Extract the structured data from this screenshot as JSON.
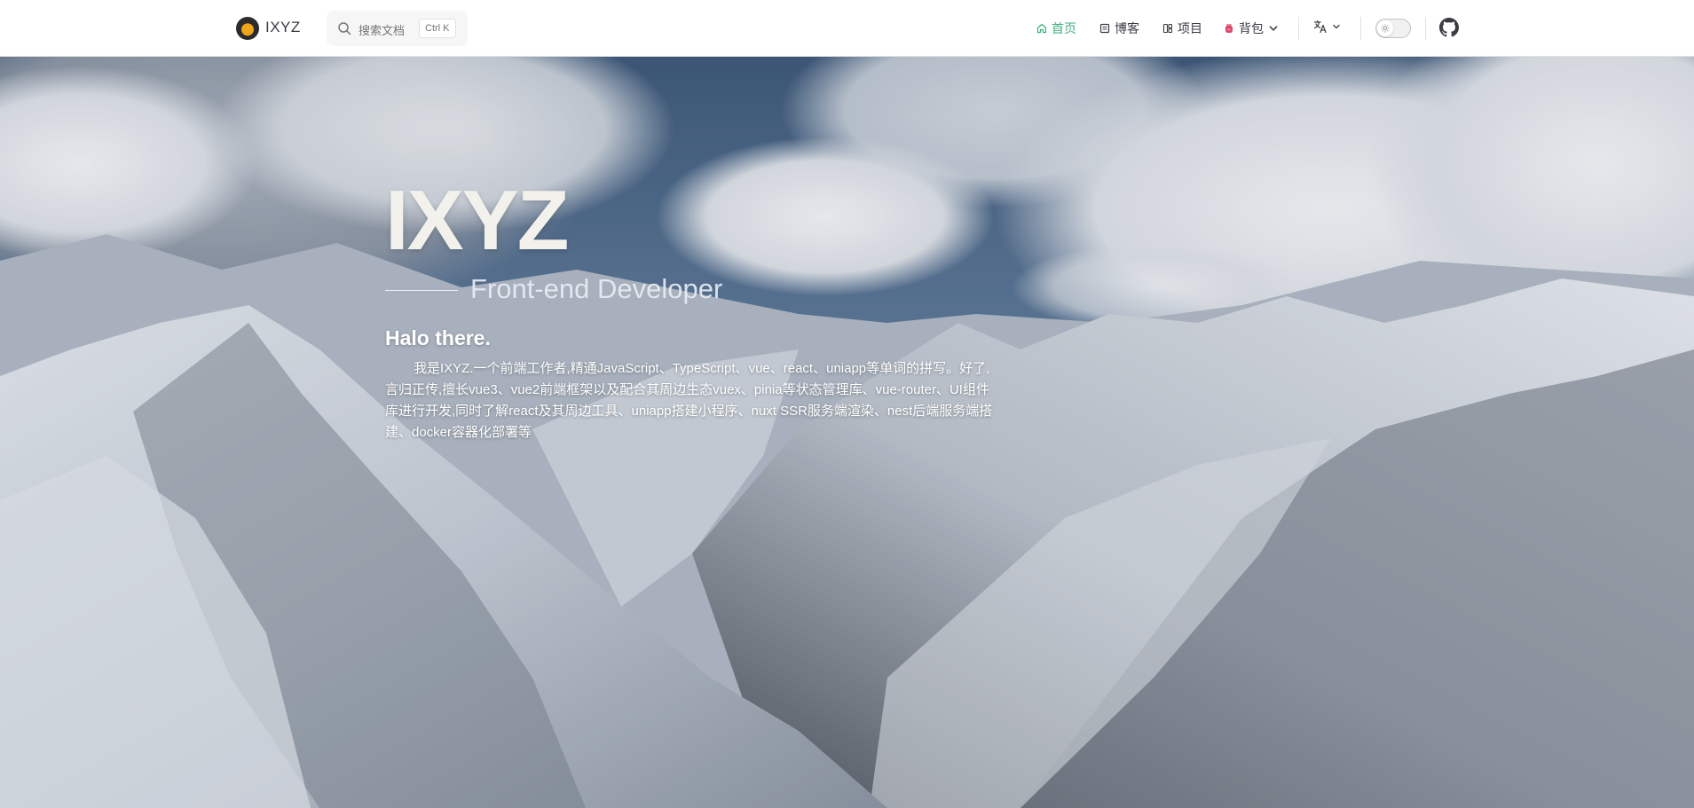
{
  "nav": {
    "brand": "IXYZ",
    "search": {
      "placeholder": "搜索文档",
      "shortcut": "Ctrl K"
    },
    "items": [
      {
        "label": "首页",
        "icon": "home-icon",
        "active": true
      },
      {
        "label": "博客",
        "icon": "document-icon"
      },
      {
        "label": "项目",
        "icon": "grid-icon"
      },
      {
        "label": "背包",
        "icon": "backpack-icon",
        "has_dropdown": true
      }
    ],
    "language_icon": "translate-icon",
    "theme_toggle_icon": "sun-icon",
    "github_icon": "github-icon",
    "accent_color": "#3eaf7c"
  },
  "hero": {
    "title": "IXYZ",
    "subtitle": "Front-end Developer",
    "greeting": "Halo there.",
    "description": "我是IXYZ.一个前端工作者,精通JavaScript、TypeScript、vue、react、uniapp等单词的拼写。好了,言归正传,擅长vue3、vue2前端框架以及配合其周边生态vuex、pinia等状态管理库、vue-router、UI组件库进行开发,同时了解react及其周边工具、uniapp搭建小程序、nuxt SSR服务端渲染、nest后端服务端搭建、docker容器化部署等"
  }
}
